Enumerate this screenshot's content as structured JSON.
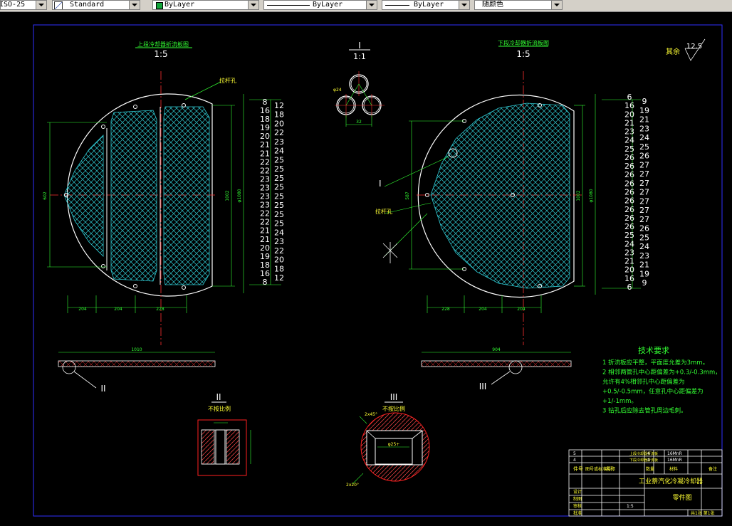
{
  "toolbar": {
    "dimstyle": "ISO-25",
    "textstyle": "Standard",
    "color": "ByLayer",
    "linetype": "ByLayer",
    "lineweight": "ByLayer",
    "plotstyle": "随颜色"
  },
  "drawing": {
    "upper_view_title": "上段冷却器折流板图",
    "upper_view_scale": "1:5",
    "lower_view_title": "下段冷却器折流板图",
    "lower_view_scale": "1:5",
    "detail_I_mark": "I",
    "detail_I_scale": "1:1",
    "roughness_label": "其余",
    "roughness_value": "12.5",
    "note_lafan": "拉杆孔",
    "callout_I": "I",
    "callout_II": "II",
    "callout_III": "III",
    "detail_II_title": "II",
    "detail_II_sub": "不按比例",
    "detail_III_title": "III",
    "detail_III_sub": "不按比例",
    "left_hole_counts_a": [
      "8",
      "16",
      "18",
      "19",
      "20",
      "21",
      "21",
      "22",
      "22",
      "23",
      "23",
      "23",
      "23",
      "22",
      "22",
      "21",
      "21",
      "20",
      "19",
      "18",
      "16",
      "8"
    ],
    "left_hole_counts_b": [
      "12",
      "18",
      "20",
      "22",
      "23",
      "24",
      "25",
      "25",
      "25",
      "25",
      "25",
      "25",
      "25",
      "25",
      "24",
      "23",
      "22",
      "20",
      "18",
      "12"
    ],
    "right_hole_counts_a": [
      "6",
      "16",
      "20",
      "21",
      "23",
      "24",
      "25",
      "26",
      "26",
      "26",
      "26",
      "26",
      "26",
      "26",
      "26",
      "26",
      "25",
      "24",
      "23",
      "21",
      "20",
      "16",
      "6"
    ],
    "right_hole_counts_b": [
      "9",
      "19",
      "21",
      "23",
      "24",
      "25",
      "26",
      "27",
      "27",
      "27",
      "27",
      "27",
      "27",
      "27",
      "26",
      "25",
      "24",
      "23",
      "21",
      "19",
      "9"
    ],
    "tech_title": "技术要求",
    "tech_notes": [
      "1  折流板应平整，平面度允差为3mm。",
      "2  相邻两管孔中心距偏差为+0.3/-0.3mm，",
      "    允许有4%相邻孔中心距偏差为",
      "    +0.5/-0.5mm，任意孔中心距偏差为",
      "    +1/-1mm。",
      "3  钻孔后应除去管孔周边毛刺。"
    ],
    "title_block_name": "工业萘汽化冷凝冷却器",
    "title_block_sub": "零件图",
    "title_block_scale": "1:5",
    "title_block_sheet": "共1张  第1张"
  }
}
